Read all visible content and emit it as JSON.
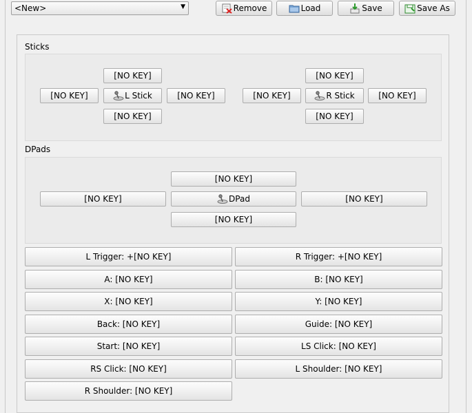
{
  "toolbar": {
    "profile": "<New>",
    "remove_label": "Remove",
    "load_label": "Load",
    "save_label": "Save",
    "save_as_label": "Save As"
  },
  "sticks": {
    "label": "Sticks",
    "left": {
      "up": "[NO KEY]",
      "left": "[NO KEY]",
      "center": "L Stick",
      "right": "[NO KEY]",
      "down": "[NO KEY]"
    },
    "right": {
      "up": "[NO KEY]",
      "left": "[NO KEY]",
      "center": "R Stick",
      "right": "[NO KEY]",
      "down": "[NO KEY]"
    }
  },
  "dpads": {
    "label": "DPads",
    "up": "[NO KEY]",
    "left": "[NO KEY]",
    "center": "DPad",
    "right": "[NO KEY]",
    "down": "[NO KEY]"
  },
  "mappings": [
    "L Trigger: +[NO KEY]",
    "R Trigger: +[NO KEY]",
    "A: [NO KEY]",
    "B: [NO KEY]",
    "X: [NO KEY]",
    "Y: [NO KEY]",
    "Back: [NO KEY]",
    "Guide: [NO KEY]",
    "Start: [NO KEY]",
    "LS Click: [NO KEY]",
    "RS Click: [NO KEY]",
    "L Shoulder: [NO KEY]",
    "R Shoulder: [NO KEY]"
  ]
}
